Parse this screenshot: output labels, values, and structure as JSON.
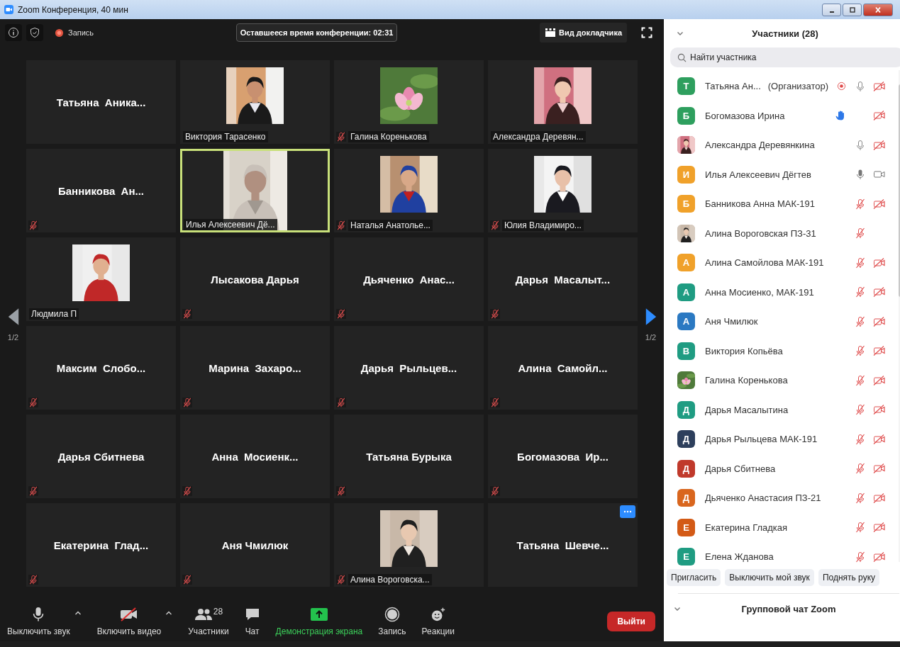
{
  "window": {
    "title": "Zoom Конференция, 40 мин"
  },
  "top_bar": {
    "recording_label": "Запись",
    "timer": "Оставшееся время конференции: 02:31",
    "view_button": "Вид докладчика"
  },
  "pager": {
    "left": "1/2",
    "right": "1/2"
  },
  "tiles": [
    {
      "name": "Татьяна  Аника...",
      "kind": "name",
      "muted": false,
      "active": false
    },
    {
      "name": "Виктория Тарасенко",
      "kind": "picture",
      "muted": false,
      "active": false
    },
    {
      "name": "Галина Коренькова",
      "kind": "picture",
      "muted": true,
      "active": false
    },
    {
      "name": "Александра Деревян...",
      "kind": "picture",
      "muted": false,
      "active": false
    },
    {
      "name": "Банникова  Ан...",
      "kind": "name",
      "muted": true,
      "active": false
    },
    {
      "name": "Илья Алексеевич Дё...",
      "kind": "picture",
      "muted": false,
      "active": true
    },
    {
      "name": "Наталья Анатолье...",
      "kind": "picture",
      "muted": true,
      "active": false
    },
    {
      "name": "Юлия Владимиро...",
      "kind": "picture",
      "muted": true,
      "active": false
    },
    {
      "name": "Людмила П",
      "kind": "picture",
      "muted": false,
      "active": false
    },
    {
      "name": "Лысакова Дарья",
      "kind": "name",
      "muted": true,
      "active": false
    },
    {
      "name": "Дьяченко  Анас...",
      "kind": "name",
      "muted": true,
      "active": false
    },
    {
      "name": "Дарья  Масалыт...",
      "kind": "name",
      "muted": true,
      "active": false
    },
    {
      "name": "Максим  Слобо...",
      "kind": "name",
      "muted": true,
      "active": false
    },
    {
      "name": "Марина  Захаро...",
      "kind": "name",
      "muted": true,
      "active": false
    },
    {
      "name": "Дарья  Рыльцев...",
      "kind": "name",
      "muted": true,
      "active": false
    },
    {
      "name": "Алина  Самойл...",
      "kind": "name",
      "muted": true,
      "active": false
    },
    {
      "name": "Дарья Сбитнева",
      "kind": "name",
      "muted": true,
      "active": false
    },
    {
      "name": "Анна  Мосиенк...",
      "kind": "name",
      "muted": true,
      "active": false
    },
    {
      "name": "Татьяна Бурыка",
      "kind": "name",
      "muted": true,
      "active": false
    },
    {
      "name": "Богомазова  Ир...",
      "kind": "name",
      "muted": true,
      "active": false
    },
    {
      "name": "Екатерина  Глад...",
      "kind": "name",
      "muted": true,
      "active": false
    },
    {
      "name": "Аня Чмилюк",
      "kind": "name",
      "muted": true,
      "active": false
    },
    {
      "name": "Алина Вороговска...",
      "kind": "picture",
      "muted": true,
      "active": false
    },
    {
      "name": "Татьяна  Шевче...",
      "kind": "name",
      "muted": false,
      "active": false,
      "more_button": true
    }
  ],
  "toolbar": [
    {
      "kind": "mic",
      "label": "Выключить звук",
      "caret": true
    },
    {
      "kind": "video",
      "label": "Включить видео",
      "caret": true
    },
    {
      "kind": "participants",
      "label": "Участники",
      "count": "28"
    },
    {
      "kind": "chat",
      "label": "Чат"
    },
    {
      "kind": "share",
      "label": "Демонстрация экрана"
    },
    {
      "kind": "record",
      "label": "Запись"
    },
    {
      "kind": "reactions",
      "label": "Реакции"
    }
  ],
  "leave_button": "Выйти",
  "panel": {
    "title": "Участники (28)",
    "search": {
      "placeholder": "Найти участника"
    },
    "participants": [
      {
        "kind": "letter",
        "letter": "Т",
        "color": "#2e9f5e",
        "name": "Татьяна Ан...",
        "role": "(Организатор)",
        "recording": true,
        "muted": false,
        "speaking": false,
        "video_off": true
      },
      {
        "kind": "letter",
        "letter": "Б",
        "color": "#2e9f5e",
        "name": "Богомазова Ирина",
        "hand": true,
        "video_off": true
      },
      {
        "kind": "picture",
        "name": "Александра Деревянкина",
        "muted": false,
        "speaking": false,
        "video_off": true
      },
      {
        "kind": "letter",
        "letter": "И",
        "color": "#f0a12a",
        "name": "Илья Алексеевич Дёгтев",
        "muted": false,
        "speaking": true,
        "video_off": false
      },
      {
        "kind": "letter",
        "letter": "Б",
        "color": "#f0a12a",
        "name": "Банникова Анна МАК-191",
        "muted": true,
        "speaking": false,
        "video_off": true
      },
      {
        "kind": "picture",
        "name": "Алина Вороговская ПЗ-31",
        "muted": true,
        "speaking": false
      },
      {
        "kind": "letter",
        "letter": "А",
        "color": "#f0a12a",
        "name": "Алина Самойлова МАК-191",
        "muted": true,
        "speaking": false,
        "video_off": true
      },
      {
        "kind": "letter",
        "letter": "А",
        "color": "#1f9c82",
        "name": "Анна Мосиенко, МАК-191",
        "muted": true,
        "speaking": false,
        "video_off": true
      },
      {
        "kind": "letter",
        "letter": "А",
        "color": "#2b79c2",
        "name": "Аня Чмилюк",
        "muted": true,
        "speaking": false,
        "video_off": true
      },
      {
        "kind": "letter",
        "letter": "В",
        "color": "#1f9c82",
        "name": "Виктория Копьёва",
        "muted": true,
        "speaking": false,
        "video_off": true
      },
      {
        "kind": "picture",
        "name": "Галина Коренькова",
        "muted": true,
        "speaking": false,
        "video_off": true
      },
      {
        "kind": "letter",
        "letter": "Д",
        "color": "#1f9c82",
        "name": "Дарья Масалытина",
        "muted": true,
        "speaking": false,
        "video_off": true
      },
      {
        "kind": "letter",
        "letter": "Д",
        "color": "#2d3f5c",
        "name": "Дарья Рыльцева МАК-191",
        "muted": true,
        "speaking": false,
        "video_off": true
      },
      {
        "kind": "letter",
        "letter": "Д",
        "color": "#c0392b",
        "name": "Дарья Сбитнева",
        "muted": true,
        "speaking": false,
        "video_off": true
      },
      {
        "kind": "letter",
        "letter": "Д",
        "color": "#d9661e",
        "name": "Дьяченко Анастасия ПЗ-21",
        "muted": true,
        "speaking": false,
        "video_off": true
      },
      {
        "kind": "letter",
        "letter": "Е",
        "color": "#d35a16",
        "name": "Екатерина Гладкая",
        "muted": true,
        "speaking": false,
        "video_off": true
      },
      {
        "kind": "letter",
        "letter": "Е",
        "color": "#1f9c82",
        "name": "Елена Жданова",
        "muted": true,
        "speaking": false,
        "video_off": true
      }
    ],
    "buttons": [
      "Пригласить",
      "Выключить мой звук",
      "Поднять руку"
    ],
    "chat_title": "Групповой чат Zoom"
  }
}
